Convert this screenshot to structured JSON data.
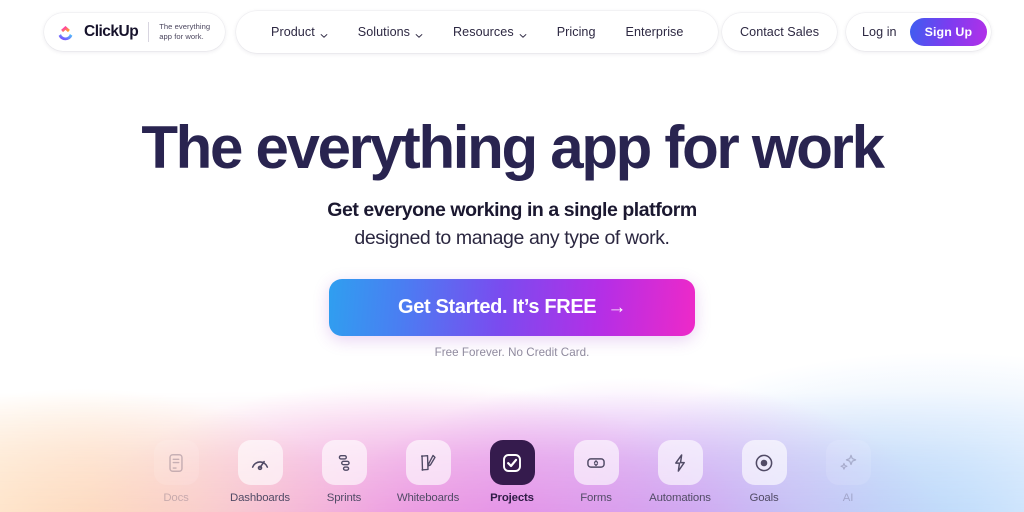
{
  "header": {
    "logo": {
      "name": "ClickUp",
      "tagline": "The everything\napp for work."
    },
    "nav": [
      {
        "label": "Product",
        "has_dropdown": true
      },
      {
        "label": "Solutions",
        "has_dropdown": true
      },
      {
        "label": "Resources",
        "has_dropdown": true
      },
      {
        "label": "Pricing",
        "has_dropdown": false
      },
      {
        "label": "Enterprise",
        "has_dropdown": false
      }
    ],
    "contact_sales": "Contact Sales",
    "login": "Log in",
    "signup": "Sign Up"
  },
  "hero": {
    "headline": "The everything app for work",
    "subheading_bold": "Get everyone working in a single platform",
    "subheading_regular": "designed to manage any type of work.",
    "cta_label": "Get Started. It’s FREE",
    "cta_arrow": "→",
    "fineprint": "Free Forever. No Credit Card."
  },
  "products": [
    {
      "label": "Docs",
      "icon": "document-icon",
      "state": "faded"
    },
    {
      "label": "Dashboards",
      "icon": "gauge-icon",
      "state": "normal"
    },
    {
      "label": "Sprints",
      "icon": "bars-icon",
      "state": "normal"
    },
    {
      "label": "Whiteboards",
      "icon": "pen-shape-icon",
      "state": "normal"
    },
    {
      "label": "Projects",
      "icon": "checkbox-icon",
      "state": "active"
    },
    {
      "label": "Forms",
      "icon": "form-field-icon",
      "state": "normal"
    },
    {
      "label": "Automations",
      "icon": "lightning-icon",
      "state": "normal"
    },
    {
      "label": "Goals",
      "icon": "target-icon",
      "state": "normal"
    },
    {
      "label": "AI",
      "icon": "sparkles-icon",
      "state": "faded"
    }
  ],
  "colors": {
    "headline": "#292450",
    "signup_gradient_start": "#3d5ef0",
    "signup_gradient_end": "#b330e8",
    "cta_gradient_start": "#2f9ff0",
    "cta_gradient_mid": "#7b4bef",
    "cta_gradient_end": "#ee29c8",
    "active_tile": "#351b4d"
  }
}
